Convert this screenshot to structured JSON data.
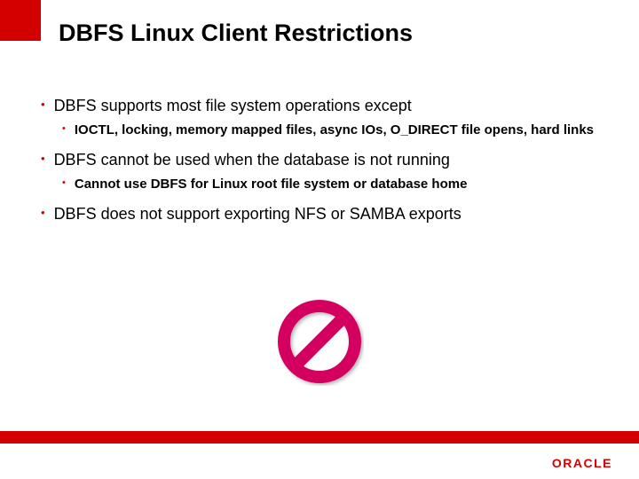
{
  "title": "DBFS Linux Client Restrictions",
  "bullets": [
    {
      "level": 1,
      "text": "DBFS supports most file system operations except"
    },
    {
      "level": 2,
      "text": "IOCTL, locking, memory mapped files, async IOs, O_DIRECT file opens, hard links"
    },
    {
      "level": 1,
      "text": "DBFS cannot be used when the database is not running"
    },
    {
      "level": 2,
      "text": "Cannot use DBFS for Linux root file system or database home"
    },
    {
      "level": 1,
      "text": "DBFS does not support exporting NFS or SAMBA exports"
    }
  ],
  "brand": "ORACLE",
  "colors": {
    "accent": "#d40000"
  }
}
